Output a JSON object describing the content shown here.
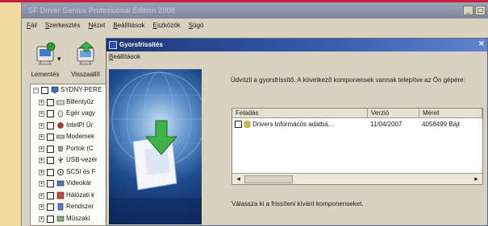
{
  "main_window": {
    "title": "SF Driver Genius Professional Edition 2008",
    "menu": [
      "Fáil",
      "Szerkesztés",
      "Nézet",
      "Beállítások",
      "Eszközök",
      "Súgó"
    ]
  },
  "toolbar": {
    "backup_label": "Lementés",
    "restore_label": "Visszaállít"
  },
  "tree": {
    "root_label": "SYDNY-PERE",
    "items": [
      "Billentyűz",
      "Egér vagy",
      "IntelPI Ūr",
      "Modemek",
      "Portok (C",
      "USB-vezér",
      "SCSI és F",
      "Videokár",
      "Hálózati k",
      "Rendszer",
      "Műszaki"
    ]
  },
  "dialog": {
    "title": "Gyorsfrissítés",
    "menu_label": "Beállítások",
    "info_text": "Üdvözli a gyorsfrissítő. A következő komponensek vannak telepítve az Ön gépére:",
    "columns": [
      "Feladás",
      "Verzió",
      "Méret"
    ],
    "rows": [
      {
        "name": "Drivers Informácós adatbá...",
        "version": "11/04/2007",
        "size": "4058499 Bájt"
      }
    ],
    "select_text": "Válassza ki a frissíteni kívánt komponenseket."
  },
  "colors": {
    "accent_strip": "#c9203e",
    "background": "#f1dc9f",
    "window_face": "#d9d2c1",
    "dialog_title": "#1c3576"
  },
  "icons": {
    "backup": "backup-icon",
    "restore": "restore-icon",
    "tree_root": "computer-icon",
    "download": "download-arrow-icon"
  }
}
